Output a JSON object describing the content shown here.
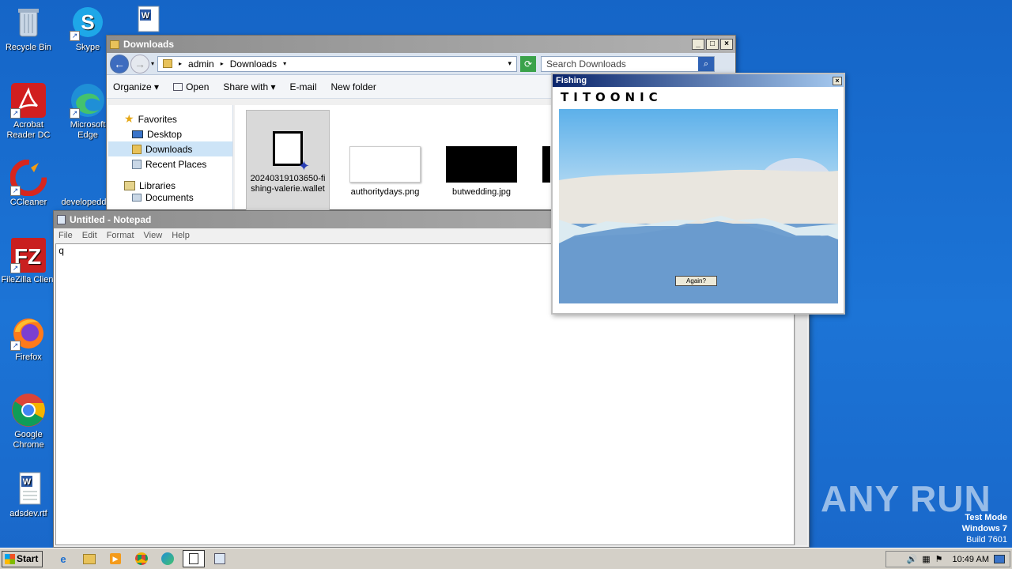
{
  "desktop": {
    "icons": [
      {
        "label": "Recycle Bin",
        "icon": "recycle-bin-icon"
      },
      {
        "label": "Skype",
        "icon": "skype-icon"
      },
      {
        "label": "Acrobat Reader DC",
        "icon": "acrobat-icon"
      },
      {
        "label": "Microsoft Edge",
        "icon": "edge-icon"
      },
      {
        "label": "CCleaner",
        "icon": "ccleaner-icon"
      },
      {
        "label": "developedd",
        "icon": "file-icon"
      },
      {
        "label": "FileZilla Client",
        "icon": "filezilla-icon"
      },
      {
        "label": "Firefox",
        "icon": "firefox-icon"
      },
      {
        "label": "Google Chrome",
        "icon": "chrome-icon"
      },
      {
        "label": "adsdev.rtf",
        "icon": "word-doc-icon"
      }
    ]
  },
  "explorer": {
    "title": "Downloads",
    "breadcrumb": [
      "admin",
      "Downloads"
    ],
    "search_placeholder": "Search Downloads",
    "commands": [
      "Organize",
      "Open",
      "Share with",
      "E-mail",
      "New folder"
    ],
    "nav": {
      "favorites": "Favorites",
      "items": [
        "Desktop",
        "Downloads",
        "Recent Places"
      ],
      "libraries": "Libraries",
      "libraries_items": [
        "Documents"
      ]
    },
    "files": [
      {
        "name": "20240319103650-fishing-valerie.wallet",
        "line1": "20240319103650-fi",
        "line2": "shing-valerie.wallet"
      },
      {
        "name": "authoritydays.png"
      },
      {
        "name": "butwedding.jpg"
      }
    ]
  },
  "notepad": {
    "title": "Untitled - Notepad",
    "menu": [
      "File",
      "Edit",
      "Format",
      "View",
      "Help"
    ],
    "content": "q"
  },
  "fishing": {
    "title": "Fishing",
    "logo": "TITOONIC",
    "button": "Again?",
    "colors": {
      "sky": "#6fb6ea",
      "ice": "#e9e6df",
      "water": "#6f9fd0"
    }
  },
  "taskbar": {
    "start": "Start",
    "pinned": [
      "ie-icon",
      "explorer-icon",
      "media-player-icon",
      "chrome-icon",
      "edge-icon",
      "notepad-icon",
      "fishing-app-icon"
    ],
    "clock": "10:49 AM"
  },
  "watermark": "ANY RUN",
  "test_mode": {
    "line1": "Test Mode",
    "line2": "Windows 7",
    "line3": "Build 7601"
  }
}
